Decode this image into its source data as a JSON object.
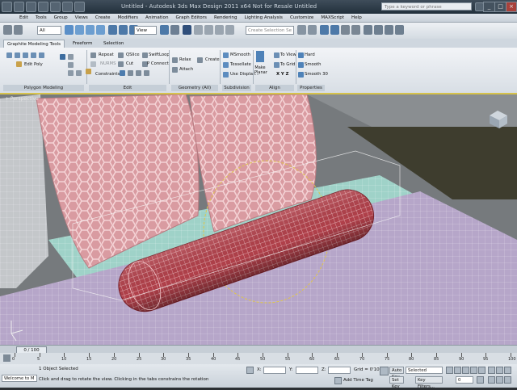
{
  "title_bar": {
    "app_title": "Untitled - Autodesk 3ds Max Design 2011 x64   Not for Resale   Untitled",
    "search_placeholder": "Type a keyword or phrase",
    "minimize": "_",
    "maximize": "□",
    "close": "×"
  },
  "menu": {
    "items": [
      "Edit",
      "Tools",
      "Group",
      "Views",
      "Create",
      "Modifiers",
      "Animation",
      "Graph Editors",
      "Rendering",
      "Lighting Analysis",
      "Customize",
      "MAXScript",
      "Help"
    ]
  },
  "toolbar": {
    "filter_value": "All",
    "refcoord_value": "View",
    "selection_set_placeholder": "Create Selection Se"
  },
  "ribbon_tabs": [
    "Graphite Modeling Tools",
    "Freeform",
    "Selection"
  ],
  "ribbon": {
    "edit_poly": "Edit Poly",
    "polygon_modeling": "Polygon Modeling",
    "repeat": "Repeat",
    "qslice": "QSlice",
    "swiftloop": "SwiftLoop",
    "normal": "NURMS",
    "cut": "Cut",
    "pconnect": "P Connect",
    "constraints": "Constraints",
    "edit_label": "Edit",
    "relax": "Relax",
    "create": "Create",
    "attach": "Attach",
    "geometry_label": "Geometry (All)",
    "msmooth": "MSmooth",
    "tessellate": "Tessellate",
    "use_displace": "Use Displac...",
    "subdivision_label": "Subdivision",
    "make_planar": "Make Planar",
    "to_view": "To View",
    "to_grid": "To Grid",
    "xyz": "X  Y  Z",
    "align_label": "Align",
    "hard": "Hard",
    "smooth": "Smooth",
    "smooth30": "Smooth 30",
    "properties_label": "Properties"
  },
  "viewport": {
    "label": "+ Perspective"
  },
  "timeline": {
    "frame_display": "0 / 100",
    "ticks": [
      "0",
      "5",
      "10",
      "15",
      "20",
      "25",
      "30",
      "35",
      "40",
      "45",
      "50",
      "55",
      "60",
      "65",
      "70",
      "75",
      "80",
      "85",
      "90",
      "95",
      "100"
    ]
  },
  "status": {
    "selection": "1 Object Selected",
    "prompt": "Click and drag to rotate the view.  Clicking in the tabs constrains the rotation",
    "welcome": "Welcome to  M",
    "x_label": "X:",
    "y_label": "Y:",
    "z_label": "Z:",
    "grid": "Grid = 0'10\"",
    "add_time_tag": "Add Time Tag",
    "auto_key": "Auto Key",
    "selected": "Selected",
    "set_key": "Set Key",
    "key_filters": "Key Filters...",
    "frame_field": "0"
  }
}
